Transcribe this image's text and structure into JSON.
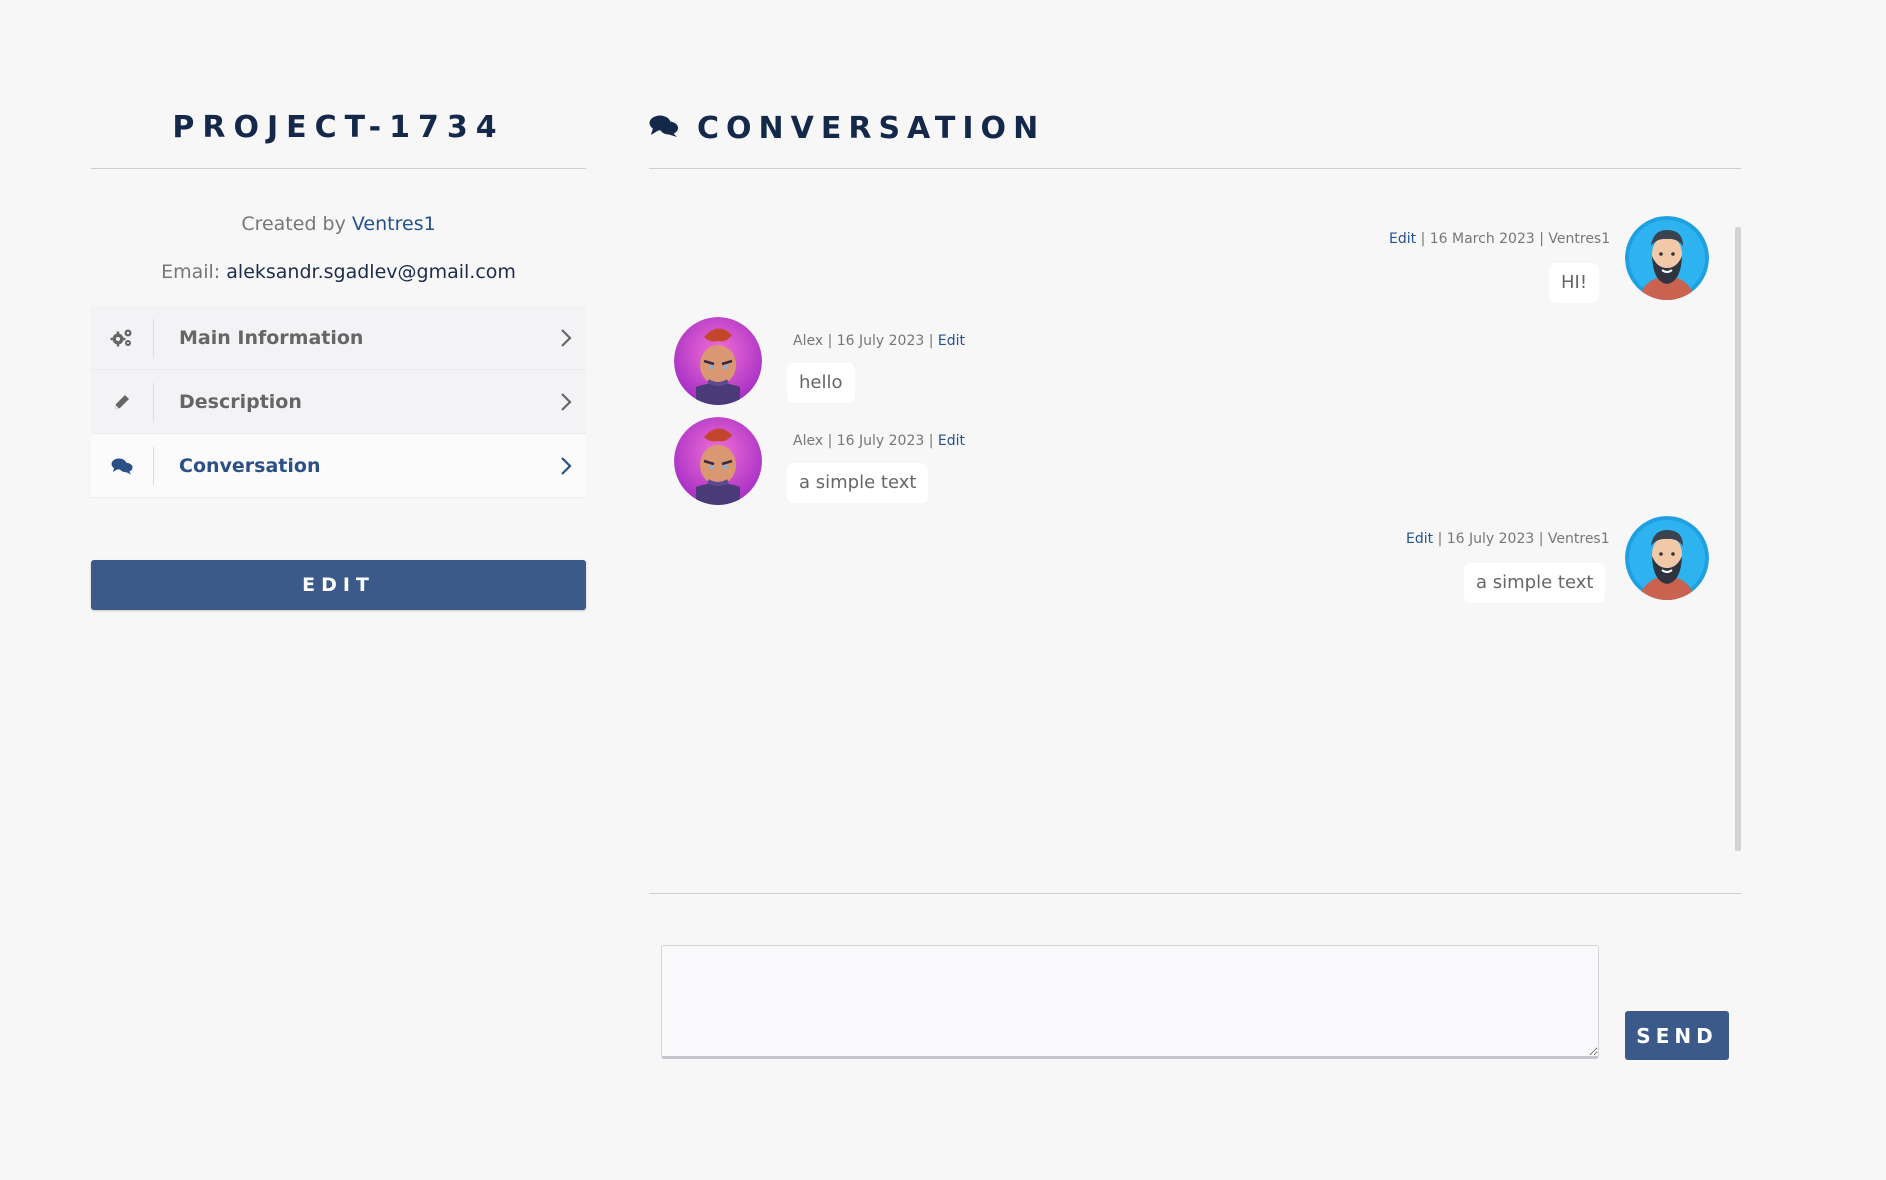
{
  "project": {
    "title": "PROJECT-1734",
    "created_prefix": "Created by",
    "creator": "Ventres1",
    "email_label": "Email:",
    "email": "aleksandr.sgadlev@gmail.com"
  },
  "menu": {
    "items": [
      {
        "label": "Main Information",
        "icon": "gears-icon",
        "active": false
      },
      {
        "label": "Description",
        "icon": "pencil-icon",
        "active": false
      },
      {
        "label": "Conversation",
        "icon": "comments-icon",
        "active": true
      }
    ]
  },
  "edit_button": "EDIT",
  "conversation": {
    "title": "CONVERSATION",
    "messages": [
      {
        "side": "right",
        "author": "Ventres1",
        "date": "16 March 2023",
        "edit": "Edit",
        "text": "HI!"
      },
      {
        "side": "left",
        "author": "Alex",
        "date": "16 July 2023",
        "edit": "Edit",
        "text": "hello"
      },
      {
        "side": "left",
        "author": "Alex",
        "date": "16 July 2023",
        "edit": "Edit",
        "text": "a simple text"
      },
      {
        "side": "right",
        "author": "Ventres1",
        "date": "16 July 2023",
        "edit": "Edit",
        "text": "a simple text"
      }
    ],
    "separator": " | "
  },
  "reply": {
    "placeholder": "",
    "value": ""
  },
  "send_button": "SEND",
  "colors": {
    "accent": "#3b5a8a",
    "title": "#14284a",
    "link": "#24518f"
  }
}
